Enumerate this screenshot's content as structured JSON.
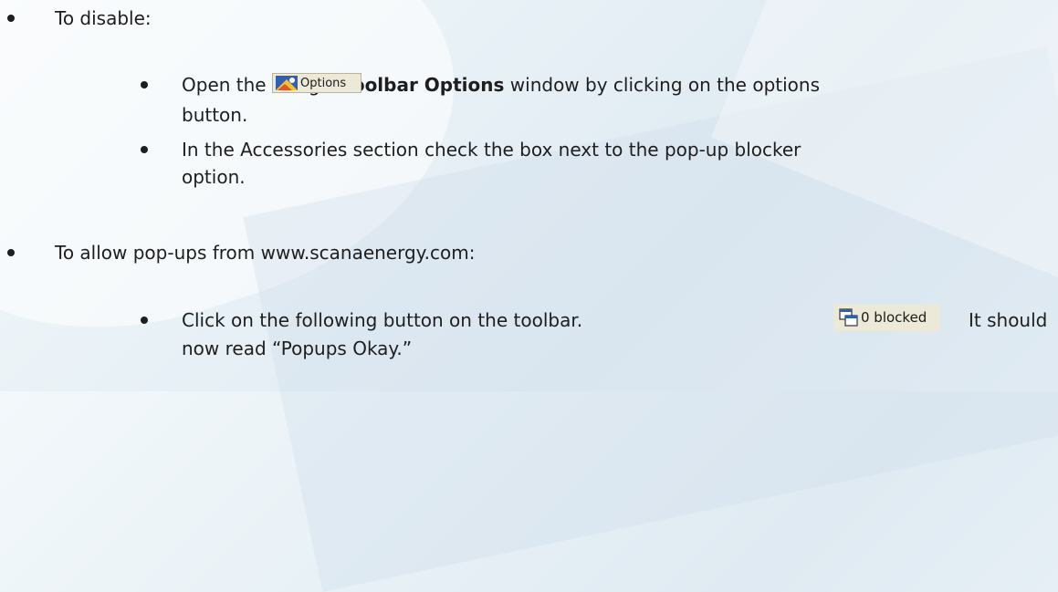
{
  "sections": [
    {
      "heading": "To disable:",
      "steps": [
        {
          "line1_prefix": "Open the Google ",
          "line1_bold": "Toolbar Options",
          "line1_suffix": " window by clicking on the options",
          "line2": "button."
        },
        {
          "line1": "In the Accessories section check the box next to the pop-up blocker",
          "line2": "option."
        }
      ]
    },
    {
      "heading": "To allow pop-ups from www.scanaenergy.com:",
      "steps": [
        {
          "line1_prefix": "Click on the following button on the toolbar.",
          "line1_suffix": "It should",
          "line2": "now read “Popups Okay.”"
        }
      ]
    }
  ],
  "options_button": {
    "label": "Options",
    "icon": "toolbar-options-icon"
  },
  "blocked_button": {
    "label": "0 blocked",
    "icon": "popup-blocker-icon"
  },
  "colors": {
    "text": "#1e1e1e",
    "button_face": "#ece9d8"
  }
}
